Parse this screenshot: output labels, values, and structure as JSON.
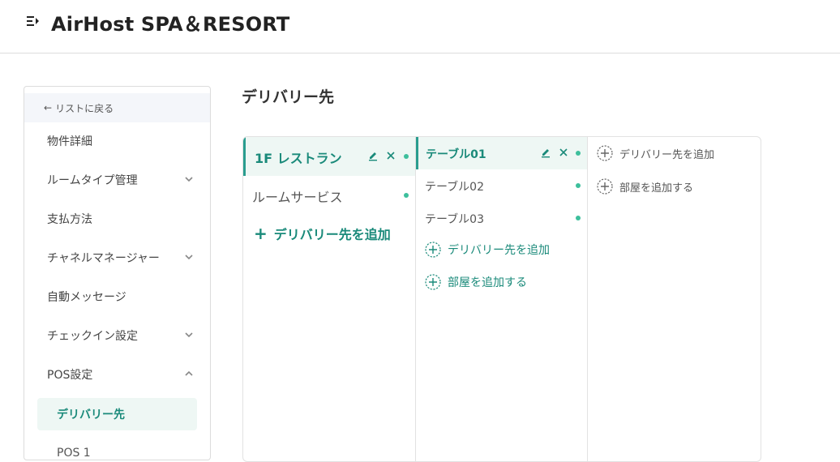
{
  "header": {
    "title": "AirHost SPA＆RESORT",
    "menu_icon": "menu-icon"
  },
  "sidebar": {
    "back_label": "リストに戻る",
    "items": [
      {
        "label": "物件詳細",
        "chevron": "none"
      },
      {
        "label": "ルームタイプ管理",
        "chevron": "down"
      },
      {
        "label": "支払方法",
        "chevron": "none"
      },
      {
        "label": "チャネルマネージャー",
        "chevron": "down"
      },
      {
        "label": "自動メッセージ",
        "chevron": "none"
      },
      {
        "label": "チェックイン設定",
        "chevron": "down"
      },
      {
        "label": "POS設定",
        "chevron": "up"
      }
    ],
    "sub_items": [
      {
        "label": "デリバリー先",
        "selected": true
      },
      {
        "label": "POS 1"
      }
    ]
  },
  "main": {
    "title": "デリバリー先",
    "col1": {
      "items": [
        {
          "label": "1F レストラン",
          "selected": true
        },
        {
          "label": "ルームサービス",
          "selected": false
        }
      ],
      "add_label": "デリバリー先を追加"
    },
    "col2": {
      "items": [
        {
          "label": "テーブル01",
          "selected": true
        },
        {
          "label": "テーブル02",
          "selected": false
        },
        {
          "label": "テーブル03",
          "selected": false
        }
      ],
      "add_delivery_label": "デリバリー先を追加",
      "add_room_label": "部屋を追加する"
    },
    "col3": {
      "add_delivery_label": "デリバリー先を追加",
      "add_room_label": "部屋を追加する"
    }
  },
  "colors": {
    "accent": "#1a8a7a",
    "accent_bg": "#eef7f4",
    "status_dot": "#3dbf9c",
    "border": "#e2e2e2"
  }
}
